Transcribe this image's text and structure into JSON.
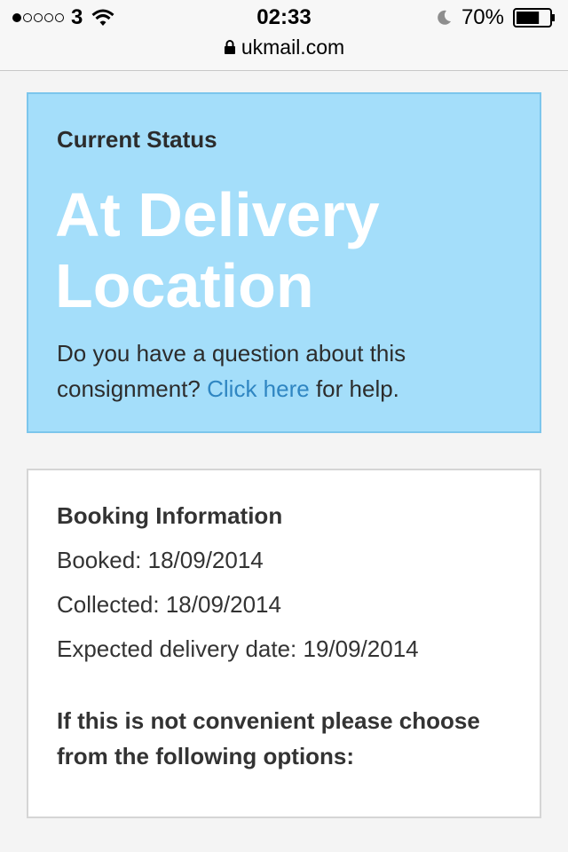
{
  "status_bar": {
    "carrier": "3",
    "time": "02:33",
    "battery": "70%",
    "signal_strength": 1,
    "signal_max": 5,
    "battery_level": 0.7,
    "icons": [
      "signal-dots-icon",
      "wifi-icon",
      "moon-icon",
      "battery-icon"
    ]
  },
  "browser": {
    "domain": "ukmail.com",
    "secure_icon": "lock-icon"
  },
  "status_card": {
    "label": "Current Status",
    "value": "At Delivery Location",
    "help_prefix": "Do you have a question about this consignment?",
    "help_link": "Click here",
    "help_suffix": "for help.",
    "background_color": "#a4defa",
    "link_color": "#2f86c2"
  },
  "booking": {
    "title": "Booking Information",
    "booked": "Booked: 18/09/2014",
    "collected": "Collected: 18/09/2014",
    "expected": "Expected delivery date: 19/09/2014",
    "options_prompt": "If this is not convenient please choose from the following options:"
  }
}
